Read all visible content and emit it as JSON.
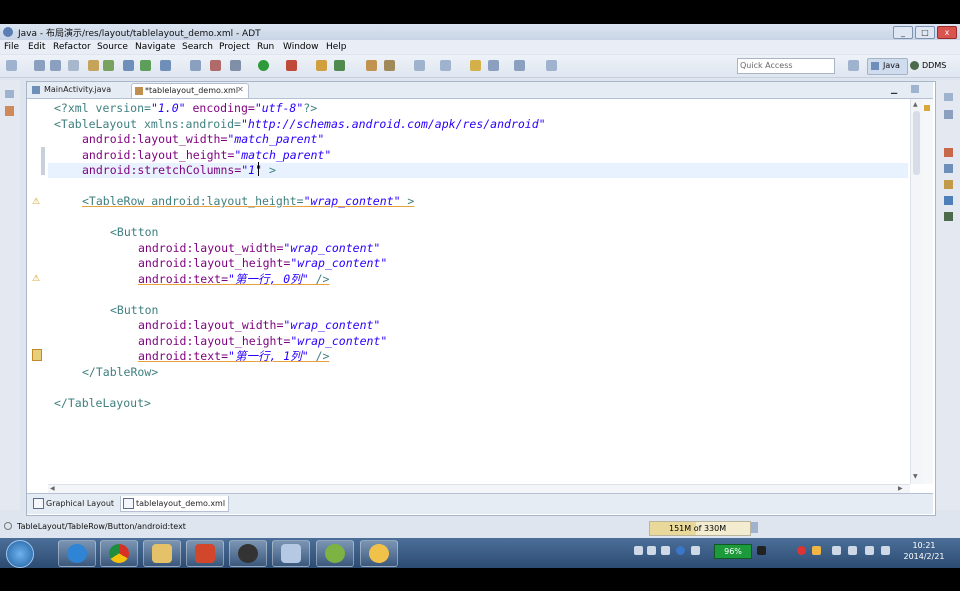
{
  "window": {
    "title": "Java - 布局演示/res/layout/tablelayout_demo.xml - ADT",
    "min": "_",
    "max": "□",
    "close": "x"
  },
  "menu": [
    "File",
    "Edit",
    "Refactor",
    "Source",
    "Navigate",
    "Search",
    "Project",
    "Run",
    "Window",
    "Help"
  ],
  "toolbar": {
    "quick_access_placeholder": "Quick Access",
    "perspective_java": "Java",
    "perspective_ddms": "DDMS"
  },
  "editor_tabs": [
    {
      "label": "MainActivity.java",
      "active": false
    },
    {
      "label": "*tablelayout_demo.xml",
      "active": true
    }
  ],
  "code": {
    "l1": {
      "a": "<?xml version=",
      "v1": "\"1.0\"",
      "b": " encoding=",
      "v2": "\"utf-8\"",
      "c": "?>"
    },
    "l2": {
      "a": "<TableLayout xmlns:android=",
      "v": "\"http://schemas.android.com/apk/res/android\""
    },
    "l3": {
      "a": "android:layout_width=",
      "v": "\"match_parent\""
    },
    "l4": {
      "a": "android:layout_height=",
      "v": "\"match_parent\""
    },
    "l5": {
      "a": "android:stretchColumns=",
      "v": "\"1\"",
      "c": " >"
    },
    "l7": {
      "a": "<TableRow android:layout_height=",
      "v": "\"wrap_content\"",
      "c": " >"
    },
    "l9": "<Button",
    "l10": {
      "a": "android:layout_width=",
      "v": "\"wrap_content\""
    },
    "l11": {
      "a": "android:layout_height=",
      "v": "\"wrap_content\""
    },
    "l12": {
      "a": "android:text=",
      "v": "\"第一行, 0列\"",
      "c": " />"
    },
    "l14": "<Button",
    "l15": {
      "a": "android:layout_width=",
      "v": "\"wrap_content\""
    },
    "l16": {
      "a": "android:layout_height=",
      "v": "\"wrap_content\""
    },
    "l17": {
      "a": "android:text=",
      "v": "\"第一行, 1列\"",
      "c": " />"
    },
    "l18": "</TableRow>",
    "l20": "</TableLayout>"
  },
  "bottom_tabs": [
    {
      "label": "Graphical Layout",
      "active": false
    },
    {
      "label": "tablelayout_demo.xml",
      "active": true
    }
  ],
  "status": {
    "path": "TableLayout/TableRow/Button/android:text",
    "heap": "151M of 330M"
  },
  "taskbar": {
    "battery": "96%",
    "time": "10:21",
    "date": "2014/2/21"
  }
}
